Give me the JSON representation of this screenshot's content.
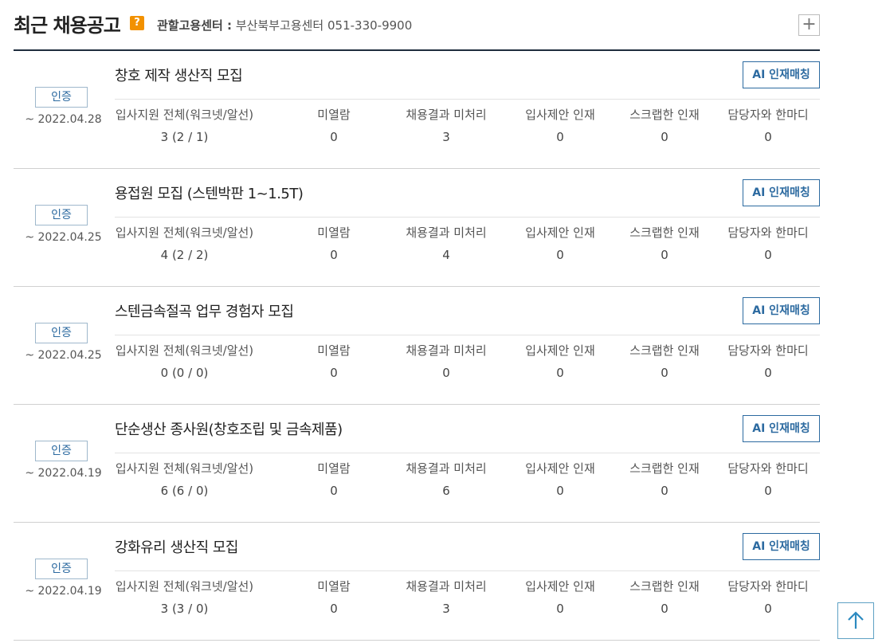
{
  "header": {
    "title": "최근 채용공고",
    "help_icon": "?",
    "center_label": "관할고용센터 :",
    "center_value": "부산북부고용센터 051-330-9900",
    "expand_icon": "+"
  },
  "stat_labels": [
    "입사지원 전체(워크넷/알선)",
    "미열람",
    "채용결과 미처리",
    "입사제안 인재",
    "스크랩한 인재",
    "담당자와 한마디"
  ],
  "ai_button_label": "AI 인재매칭",
  "jobs": [
    {
      "badge": "인증",
      "deadline": "~ 2022.04.28",
      "title": "창호 제작 생산직 모집",
      "values": [
        "3 (2 / 1)",
        "0",
        "3",
        "0",
        "0",
        "0"
      ]
    },
    {
      "badge": "인증",
      "deadline": "~ 2022.04.25",
      "title": "용접원 모집 (스텐박판 1~1.5T)",
      "values": [
        "4 (2 / 2)",
        "0",
        "4",
        "0",
        "0",
        "0"
      ]
    },
    {
      "badge": "인증",
      "deadline": "~ 2022.04.25",
      "title": "스텐금속절곡 업무 경험자 모집",
      "values": [
        "0 (0 / 0)",
        "0",
        "0",
        "0",
        "0",
        "0"
      ]
    },
    {
      "badge": "인증",
      "deadline": "~ 2022.04.19",
      "title": "단순생산 종사원(창호조립 및 금속제품)",
      "values": [
        "6 (6 / 0)",
        "0",
        "6",
        "0",
        "0",
        "0"
      ]
    },
    {
      "badge": "인증",
      "deadline": "~ 2022.04.19",
      "title": "강화유리 생산직 모집",
      "values": [
        "3 (3 / 0)",
        "0",
        "3",
        "0",
        "0",
        "0"
      ]
    }
  ],
  "colors": {
    "accent": "#2c6aa0",
    "help_badge": "#f29100",
    "header_rule": "#1f2d3d"
  },
  "icons": {
    "help": "question-icon",
    "expand": "plus-icon",
    "top": "arrow-up-icon"
  }
}
